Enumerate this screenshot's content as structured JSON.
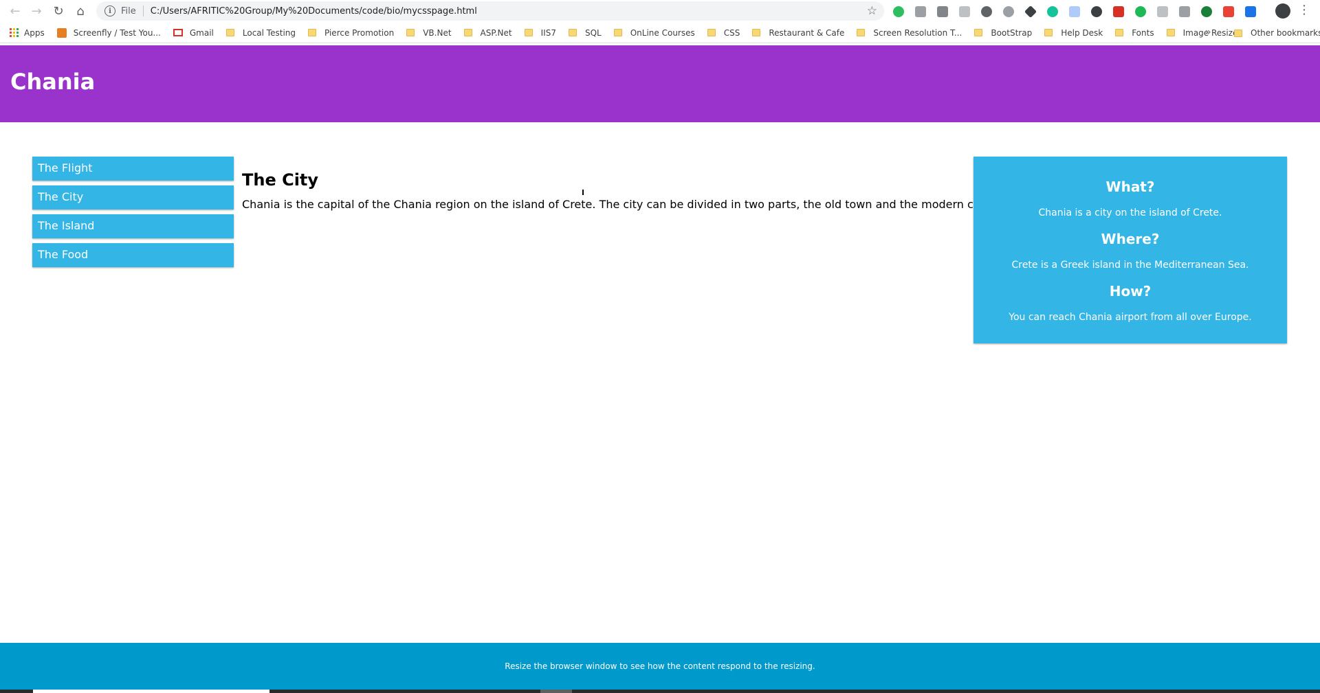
{
  "browser": {
    "address_scheme": "File",
    "address_url": "C:/Users/AFRITIC%20Group/My%20Documents/code/bio/mycsspage.html",
    "bookmarks": [
      {
        "label": "Apps",
        "icon": "apps-icon"
      },
      {
        "label": "Screenfly / Test You...",
        "icon": "screenfly-icon"
      },
      {
        "label": "Gmail",
        "icon": "gmail-icon"
      },
      {
        "label": "Local Testing",
        "icon": "folder-icon"
      },
      {
        "label": "Pierce Promotion",
        "icon": "folder-icon"
      },
      {
        "label": "VB.Net",
        "icon": "folder-icon"
      },
      {
        "label": "ASP.Net",
        "icon": "folder-icon"
      },
      {
        "label": "IIS7",
        "icon": "folder-icon"
      },
      {
        "label": "SQL",
        "icon": "folder-icon"
      },
      {
        "label": "OnLine Courses",
        "icon": "folder-icon"
      },
      {
        "label": "CSS",
        "icon": "folder-icon"
      },
      {
        "label": "Restaurant & Cafe",
        "icon": "folder-icon"
      },
      {
        "label": "Screen Resolution T...",
        "icon": "folder-icon"
      },
      {
        "label": "BootStrap",
        "icon": "folder-icon"
      },
      {
        "label": "Help Desk",
        "icon": "folder-icon"
      },
      {
        "label": "Fonts",
        "icon": "folder-icon"
      },
      {
        "label": "Image Resizer",
        "icon": "folder-icon"
      }
    ],
    "bookmarks_overflow": "»",
    "other_bookmarks": "Other bookmarks"
  },
  "header": {
    "title": "Chania"
  },
  "menu": {
    "items": [
      {
        "label": "The Flight"
      },
      {
        "label": "The City"
      },
      {
        "label": "The Island"
      },
      {
        "label": "The Food"
      }
    ]
  },
  "main": {
    "heading": "The City",
    "paragraph": "Chania is the capital of the Chania region on the island of Crete. The city can be divided in two parts, the old town and the modern city."
  },
  "aside": {
    "sections": [
      {
        "heading": "What?",
        "text": "Chania is a city on the island of Crete."
      },
      {
        "heading": "Where?",
        "text": "Crete is a Greek island in the Mediterranean Sea."
      },
      {
        "heading": "How?",
        "text": "You can reach Chania airport from all over Europe."
      }
    ]
  },
  "footer": {
    "text": "Resize the browser window to see how the content respond to the resizing."
  },
  "colors": {
    "header_bg": "#9933cc",
    "menu_bg": "#33b5e5",
    "aside_bg": "#33b5e5",
    "footer_bg": "#0099cc"
  }
}
